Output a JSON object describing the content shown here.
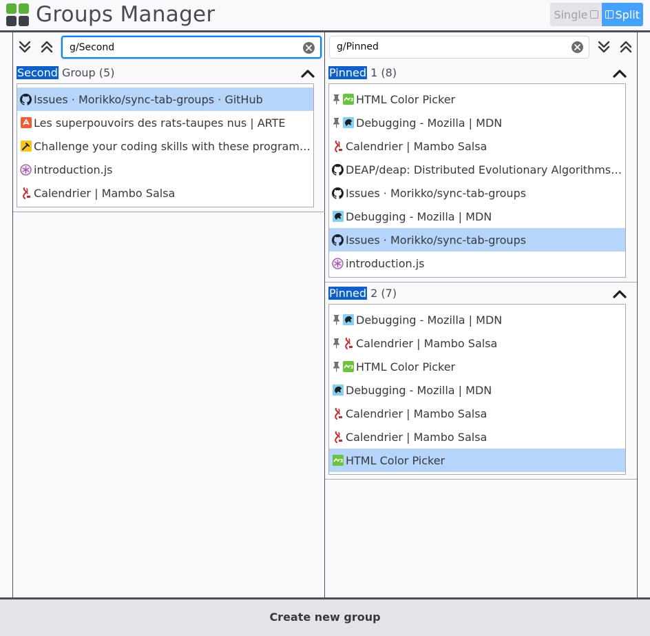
{
  "app": {
    "title": "Groups Manager",
    "brand_colors": [
      "#5bb135",
      "#3b3f47"
    ]
  },
  "mode_switch": {
    "single_label": "Single",
    "split_label": "Split",
    "active": "split"
  },
  "left_panel": {
    "search": {
      "value": "g/Second",
      "focused": true
    },
    "groups": [
      {
        "title_highlight": "Second",
        "title_rest": " Group",
        "count": "(5)",
        "tabs": [
          {
            "title": "Issues · Morikko/sync-tab-groups · GitHub",
            "icon": "github-icon",
            "pinned": false,
            "selected": true
          },
          {
            "title": "Les superpouvoirs des rats-taupes nus | ARTE",
            "icon": "arte-icon",
            "pinned": false,
            "selected": false
          },
          {
            "title": "Challenge your coding skills with these programming challenges",
            "icon": "codewars-icon",
            "pinned": false,
            "selected": false
          },
          {
            "title": "introduction.js",
            "icon": "introjs-icon",
            "pinned": false,
            "selected": false
          },
          {
            "title": "Calendrier | Mambo Salsa",
            "icon": "mambo-salsa-icon",
            "pinned": false,
            "selected": false
          }
        ]
      }
    ]
  },
  "right_panel": {
    "search": {
      "value": "g/Pinned",
      "focused": false
    },
    "groups": [
      {
        "title_highlight": "Pinned",
        "title_rest": " 1",
        "count": "(8)",
        "tabs": [
          {
            "title": "HTML Color Picker",
            "icon": "color-picker-icon",
            "pinned": true,
            "selected": false
          },
          {
            "title": "Debugging - Mozilla | MDN",
            "icon": "mdn-icon",
            "pinned": true,
            "selected": false
          },
          {
            "title": "Calendrier | Mambo Salsa",
            "icon": "mambo-salsa-icon",
            "pinned": false,
            "selected": false
          },
          {
            "title": "DEAP/deap: Distributed Evolutionary Algorithms in Python",
            "icon": "github-icon",
            "pinned": false,
            "selected": false
          },
          {
            "title": "Issues · Morikko/sync-tab-groups",
            "icon": "github-icon",
            "pinned": false,
            "selected": false
          },
          {
            "title": "Debugging - Mozilla | MDN",
            "icon": "mdn-icon",
            "pinned": false,
            "selected": false
          },
          {
            "title": "Issues · Morikko/sync-tab-groups",
            "icon": "github-icon",
            "pinned": false,
            "selected": true
          },
          {
            "title": "introduction.js",
            "icon": "introjs-icon",
            "pinned": false,
            "selected": false
          }
        ]
      },
      {
        "title_highlight": "Pinned",
        "title_rest": " 2",
        "count": "(7)",
        "tabs": [
          {
            "title": "Debugging - Mozilla | MDN",
            "icon": "mdn-icon",
            "pinned": true,
            "selected": false
          },
          {
            "title": "Calendrier | Mambo Salsa",
            "icon": "mambo-salsa-icon",
            "pinned": true,
            "selected": false
          },
          {
            "title": "HTML Color Picker",
            "icon": "color-picker-icon",
            "pinned": true,
            "selected": false
          },
          {
            "title": "Debugging - Mozilla | MDN",
            "icon": "mdn-icon",
            "pinned": false,
            "selected": false
          },
          {
            "title": "Calendrier | Mambo Salsa",
            "icon": "mambo-salsa-icon",
            "pinned": false,
            "selected": false
          },
          {
            "title": "Calendrier | Mambo Salsa",
            "icon": "mambo-salsa-icon",
            "pinned": false,
            "selected": false
          },
          {
            "title": "HTML Color Picker",
            "icon": "color-picker-icon",
            "pinned": false,
            "selected": true
          }
        ]
      }
    ]
  },
  "footer": {
    "create_label": "Create new group"
  },
  "colors": {
    "selection": "#b6d5fa",
    "highlight": "#0a60d0",
    "focus_ring": "#0a84ff",
    "split_active": "#45a1ff"
  }
}
